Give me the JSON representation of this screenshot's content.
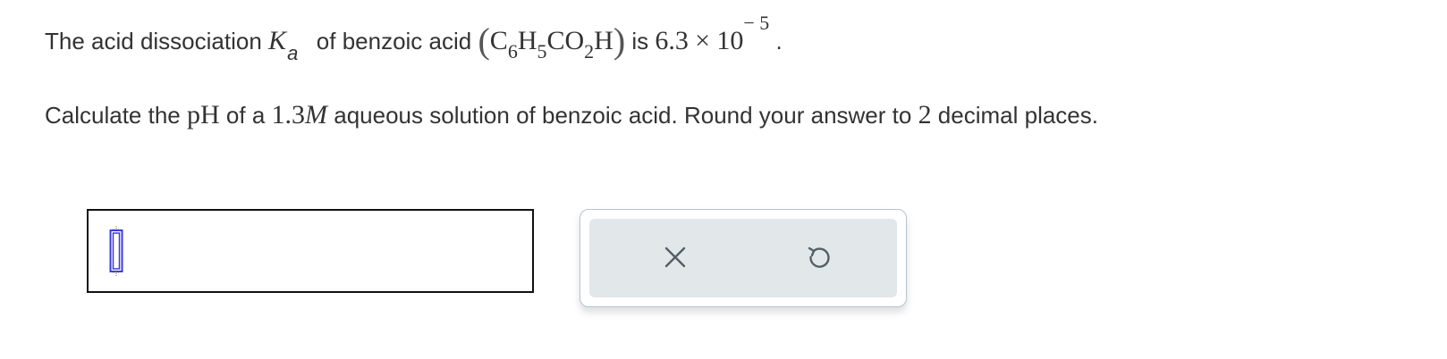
{
  "question": {
    "line1": {
      "text_before": "The acid dissociation",
      "ka_symbol": "K",
      "ka_subscript": "a",
      "text_of": "of benzoic acid",
      "formula": {
        "open_paren": "(",
        "C": "C",
        "C_sub": "6",
        "H": "H",
        "H_sub": "5",
        "CO": "CO",
        "O_sub": "2",
        "H_end": "H",
        "close_paren": ")"
      },
      "text_is": "is",
      "value_mantissa": "6.3",
      "times": "×",
      "value_base": "10",
      "value_exponent": "− 5",
      "period": "."
    },
    "line2": {
      "text_start": "Calculate the",
      "ph": "pH",
      "text_of_a": "of a",
      "concentration": "1.3",
      "molar_unit": "M",
      "text_solution": "aqueous solution of benzoic acid. Round your answer to",
      "decimals": "2",
      "text_end": "decimal places."
    }
  },
  "answer": {
    "value": ""
  },
  "tools": {
    "clear_icon": "x-icon",
    "undo_icon": "undo-icon"
  },
  "colors": {
    "cursor": "#3a3ae0",
    "panel_bg": "#e2e7ea",
    "panel_border": "#b9c4cc",
    "icon": "#555f66"
  }
}
